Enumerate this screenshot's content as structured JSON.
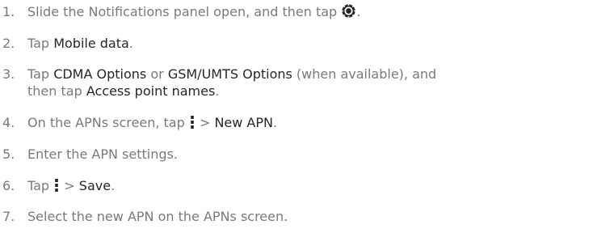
{
  "steps": [
    {
      "num": "1.",
      "a": "Slide the Notifications panel open, and then tap",
      "b": "."
    },
    {
      "num": "2.",
      "a": "Tap",
      "bold1": "Mobile data",
      "b": "."
    },
    {
      "num": "3.",
      "a": "Tap",
      "bold1": "CDMA Options",
      "mid": "or",
      "bold2": "GSM/UMTS Options",
      "c": "(when available), and",
      "line2a": "then tap",
      "bold3": "Access point names",
      "line2b": "."
    },
    {
      "num": "4.",
      "a": "On the APNs screen, tap",
      "sep": ">",
      "bold1": "New APN",
      "b": "."
    },
    {
      "num": "5.",
      "a": "Enter the APN settings."
    },
    {
      "num": "6.",
      "a": "Tap",
      "sep": ">",
      "bold1": "Save",
      "b": "."
    },
    {
      "num": "7.",
      "a": "Select the new APN on the APNs screen."
    }
  ],
  "icons": {
    "settings": "settings-gear-icon",
    "menu": "overflow-menu-icon"
  },
  "colors": {
    "text": "#7a7a7a",
    "emphasis": "#262626"
  }
}
